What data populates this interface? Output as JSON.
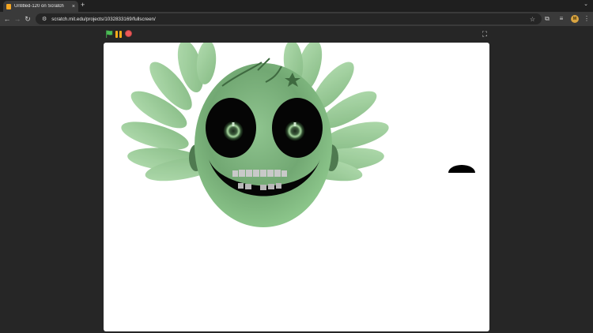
{
  "browser": {
    "tab_title": "Untitled-120 on Scratch",
    "tab_close": "×",
    "new_tab": "+",
    "tab_menu": "⌄",
    "url": "scratch.mit.edu/projects/1032833169/fullscreen/",
    "back": "←",
    "forward": "→",
    "reload": "↻",
    "star": "☆",
    "site_info": "⚙",
    "extensions": "⧉",
    "media": "≡",
    "menu": "⋮",
    "profile_initials": "M"
  },
  "player": {
    "fullscreen_glyph": "⛶",
    "colors": {
      "flag": "#4cbf56",
      "pause": "#ffab19",
      "stop": "#ec5959"
    }
  },
  "stage": {
    "background": "#ffffff",
    "sprites": [
      "green-monster-face",
      "black-semicircle"
    ]
  }
}
